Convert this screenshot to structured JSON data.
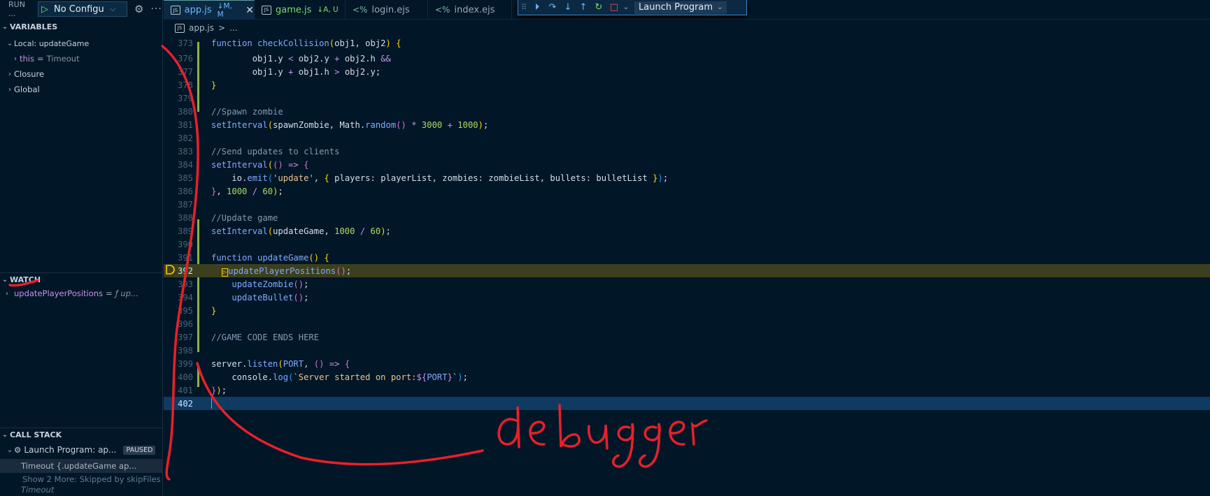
{
  "sidebar": {
    "run_title": "RUN ...",
    "config_label": "No Configu",
    "variables_header": "VARIABLES",
    "local_scope": "Local: updateGame",
    "this_name": "this",
    "this_value": "Timeout",
    "closure": "Closure",
    "global": "Global",
    "watch_header": "WATCH",
    "watch_name": "updatePlayerPositions",
    "watch_value": "ƒ up...",
    "callstack_header": "CALL STACK",
    "launch_item": "Launch Program: ap...",
    "paused": "PAUSED",
    "frame": "Timeout {.updateGame  ap...",
    "show_more": "Show 2 More: Skipped by skipFiles",
    "timeout_label": "Timeout"
  },
  "tabs": [
    {
      "label": "app.js",
      "status": "↓M, M",
      "color": "#6cb6ff"
    },
    {
      "label": "game.js",
      "status": "↓A, U",
      "color": "#7fdb6a"
    },
    {
      "label": "login.ejs",
      "status": "",
      "color": "#9aa8b8"
    },
    {
      "label": "index.ejs",
      "status": "",
      "color": "#9aa8b8"
    }
  ],
  "debug_toolbar": {
    "launch_label": "Launch Program"
  },
  "breadcrumb": {
    "file": "app.js",
    "sep": ">",
    "rest": "..."
  },
  "line_numbers": [
    "373",
    "376",
    "377",
    "378",
    "379",
    "380",
    "381",
    "382",
    "383",
    "384",
    "385",
    "386",
    "387",
    "388",
    "389",
    "390",
    "391",
    "392",
    "393",
    "394",
    "395",
    "396",
    "397",
    "398",
    "399",
    "400",
    "401",
    "402"
  ],
  "annotation": {
    "text": "debugger",
    "color": "#e8202a"
  },
  "colors": {
    "background": "#011627",
    "exec_line": "#3b3f1e",
    "cursor_line": "#0f3b62",
    "annotation": "#e8202a"
  }
}
